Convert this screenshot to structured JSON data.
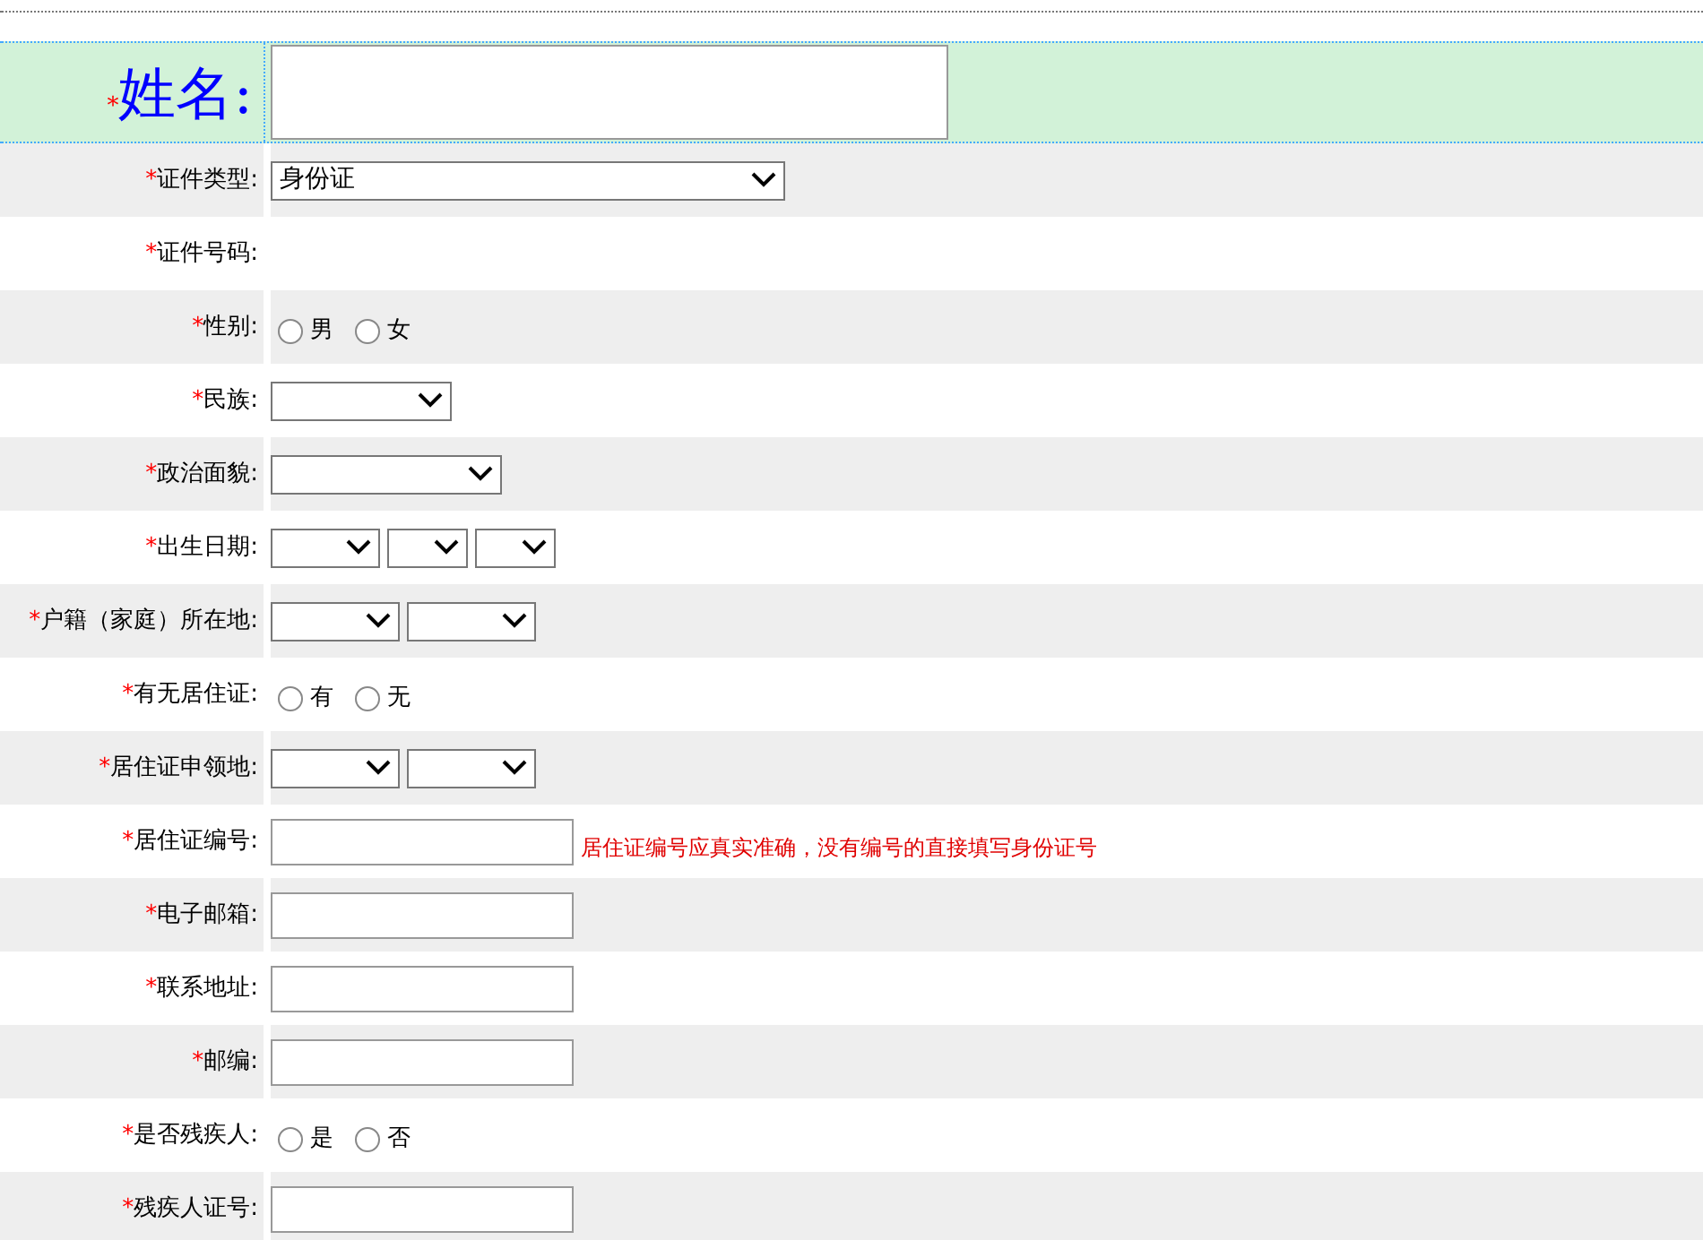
{
  "name_row": {
    "star": "*",
    "label": "姓名:"
  },
  "rows": [
    {
      "kind": "select",
      "star": "*",
      "label": "证件类型:",
      "selects": [
        {
          "kind": "dropdown",
          "value": "身份证"
        }
      ]
    },
    {
      "kind": "empty",
      "star": "*",
      "label": "证件号码:"
    },
    {
      "kind": "radio",
      "star": "*",
      "label": "性别:",
      "options": [
        {
          "label": "男",
          "selected": false
        },
        {
          "label": "女",
          "selected": false
        }
      ]
    },
    {
      "kind": "select",
      "star": "*",
      "label": "民族:",
      "selects": [
        {
          "kind": "dropdown"
        }
      ]
    },
    {
      "kind": "select",
      "star": "*",
      "label": "政治面貌:",
      "selects": [
        {
          "kind": "dropdown"
        }
      ]
    },
    {
      "kind": "select",
      "star": "*",
      "label": "出生日期:",
      "selects": [
        {
          "kind": "dropdown"
        },
        {
          "kind": "dropdown"
        },
        {
          "kind": "dropdown"
        }
      ]
    },
    {
      "kind": "select",
      "star": "*",
      "label": "户籍（家庭）所在地:",
      "selects": [
        {
          "kind": "dropdown"
        },
        {
          "kind": "dropdown"
        }
      ]
    },
    {
      "kind": "radio",
      "star": "*",
      "label": "有无居住证:",
      "options": [
        {
          "label": "有",
          "selected": false
        },
        {
          "label": "无",
          "selected": false
        }
      ]
    },
    {
      "kind": "select",
      "star": "*",
      "label": "居住证申领地:",
      "selects": [
        {
          "kind": "dropdown"
        },
        {
          "kind": "dropdown"
        }
      ]
    },
    {
      "kind": "input",
      "star": "*",
      "label": "居住证编号:",
      "hint": "居住证编号应真实准确，没有编号的直接填写身份证号"
    },
    {
      "kind": "input",
      "star": "*",
      "label": "电子邮箱:"
    },
    {
      "kind": "input",
      "star": "*",
      "label": "联系地址:"
    },
    {
      "kind": "input",
      "star": "*",
      "label": "邮编:"
    },
    {
      "kind": "radio",
      "star": "*",
      "label": "是否残疾人:",
      "options": [
        {
          "label": "是",
          "selected": false
        },
        {
          "label": "否",
          "selected": false
        }
      ]
    },
    {
      "kind": "input",
      "star": "*",
      "label": "残疾人证号:"
    }
  ]
}
